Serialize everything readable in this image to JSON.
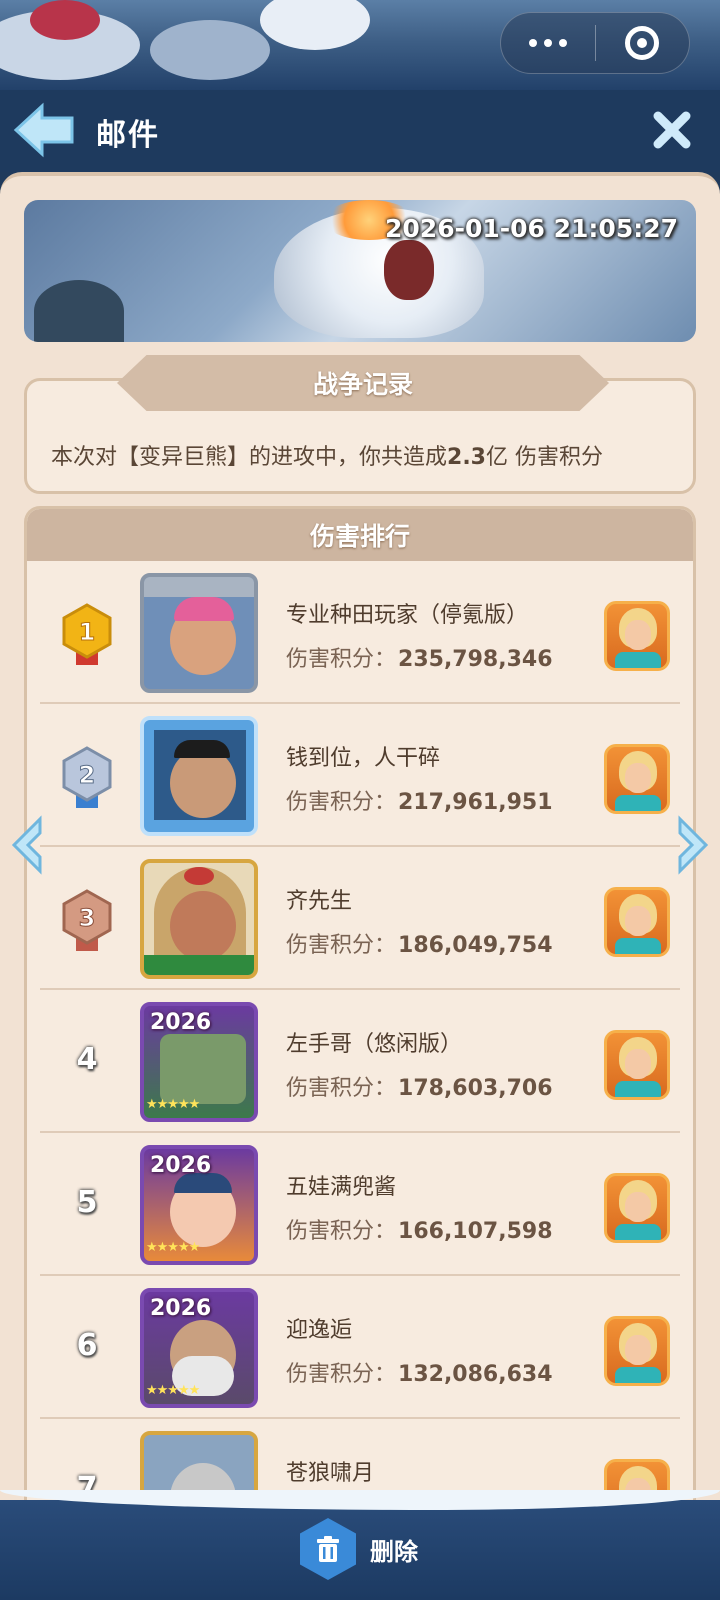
{
  "header": {
    "title": "邮件",
    "back_icon": "back-arrow-icon",
    "close_icon": "close-icon",
    "menu_icon": "more-dots-icon",
    "target_icon": "target-icon"
  },
  "banner": {
    "timestamp": "2026-01-06 21:05:27"
  },
  "record": {
    "title": "战争记录",
    "text_before": "本次对【变异巨熊】的进攻中，你共造成",
    "damage_value": "2.3",
    "text_after": "亿 伤害积分"
  },
  "ranking": {
    "title": "伤害排行",
    "score_label": "伤害积分：",
    "entries": [
      {
        "rank": "1",
        "name": "专业种田玩家（停氪版）",
        "score": "235,798,346",
        "medal": "gold"
      },
      {
        "rank": "2",
        "name": "钱到位，人干碎",
        "score": "217,961,951",
        "medal": "silver"
      },
      {
        "rank": "3",
        "name": "齐先生",
        "score": "186,049,754",
        "medal": "bronze"
      },
      {
        "rank": "4",
        "name": "左手哥（悠闲版）",
        "score": "178,603,706",
        "frame_tag": "2026"
      },
      {
        "rank": "5",
        "name": "五娃满兜酱",
        "score": "166,107,598",
        "frame_tag": "2026"
      },
      {
        "rank": "6",
        "name": "迎逸逅",
        "score": "132,086,634",
        "frame_tag": "2026"
      },
      {
        "rank": "7",
        "name": "苍狼啸月",
        "score": ""
      }
    ]
  },
  "bottom": {
    "delete_label": "删除",
    "delete_icon": "trash-icon"
  },
  "colors": {
    "panel_bg": "#f2e2d3",
    "header_bg": "#1e3a5e",
    "ribbon": "#cdb5a0",
    "text_brown": "#5a4636"
  }
}
